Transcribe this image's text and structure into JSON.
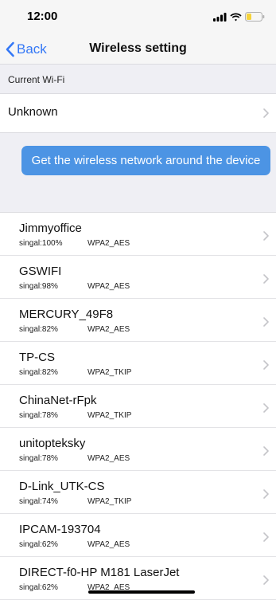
{
  "status_bar": {
    "time": "12:00"
  },
  "nav": {
    "back_label": "Back",
    "title": "Wireless setting"
  },
  "current_wifi": {
    "header": "Current Wi-Fi",
    "value": "Unknown"
  },
  "scan_button": {
    "label": "Get the wireless network around the device"
  },
  "networks": [
    {
      "ssid": "Jimmyoffice",
      "signal": "singal:100%",
      "security": "WPA2_AES"
    },
    {
      "ssid": "GSWIFI",
      "signal": "singal:98%",
      "security": "WPA2_AES"
    },
    {
      "ssid": "MERCURY_49F8",
      "signal": "singal:82%",
      "security": "WPA2_AES"
    },
    {
      "ssid": "TP-CS",
      "signal": "singal:82%",
      "security": "WPA2_TKIP"
    },
    {
      "ssid": "ChinaNet-rFpk",
      "signal": "singal:78%",
      "security": "WPA2_TKIP"
    },
    {
      "ssid": "unitopteksky",
      "signal": "singal:78%",
      "security": "WPA2_AES"
    },
    {
      "ssid": "D-Link_UTK-CS",
      "signal": "singal:74%",
      "security": "WPA2_TKIP"
    },
    {
      "ssid": "IPCAM-193704",
      "signal": "singal:62%",
      "security": "WPA2_AES"
    },
    {
      "ssid": "DIRECT-f0-HP M181 LaserJet",
      "signal": "singal:62%",
      "security": "WPA2_AES"
    }
  ],
  "colors": {
    "accent": "#3478f6",
    "button": "#4c94e4",
    "battery": "#f5d33a",
    "group_bg": "#efeff4"
  }
}
